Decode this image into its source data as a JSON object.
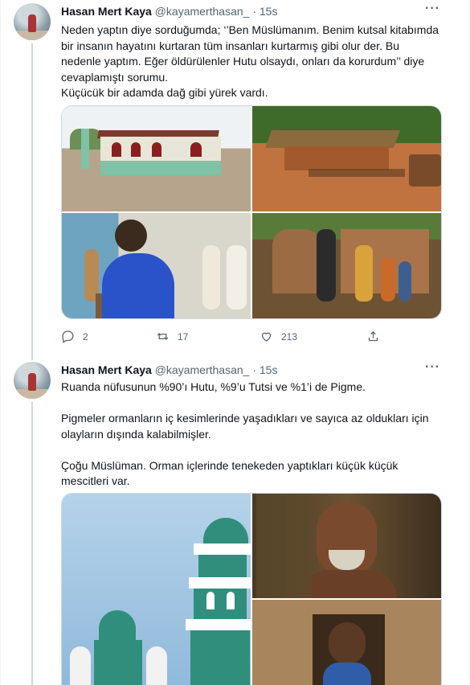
{
  "tweets": [
    {
      "author": {
        "name": "Hasan Mert Kaya",
        "handle": "@kayamerthasan_",
        "time": "15s"
      },
      "lines": [
        "Neden yaptın diye sorduğumda; ‘’Ben Müslümanım. Benim kutsal kitabımda",
        "bir insanın hayatını kurtaran tüm insanları kurtarmış gibi olur der. Bu",
        "nedenle yaptım. Eğer öldürülenler Hutu olsaydı, onları da korurdum’’ diye",
        "cevaplamıştı sorumu.",
        "Küçücük bir adamda dağ gibi yürek vardı."
      ],
      "media_desc": [
        "mosque-photo",
        "village-hut-photo",
        "men-praying-photo",
        "pygmy-family-photo"
      ],
      "actions": {
        "replies": "2",
        "retweets": "17",
        "likes": "213"
      }
    },
    {
      "author": {
        "name": "Hasan Mert Kaya",
        "handle": "@kayamerthasan_",
        "time": "15s"
      },
      "paragraphs": [
        "Ruanda nüfusunun %90’ı Hutu, %9’u Tutsi ve %1’i de Pigme.",
        "Pigmeler ormanların iç kesimlerinde yaşadıkları ve sayıca az oldukları için",
        "olayların dışında kalabilmişler.",
        "Çoğu Müslüman. Orman içlerinde tenekeden yaptıkları küçük küçük",
        "mescitleri var."
      ],
      "media_desc": [
        "green-mosque-photo",
        "elder-portrait-photo",
        "boy-in-window-photo"
      ]
    }
  ],
  "colors": {
    "text": "#0f1419",
    "muted": "#536471",
    "border": "#cfd9de"
  }
}
